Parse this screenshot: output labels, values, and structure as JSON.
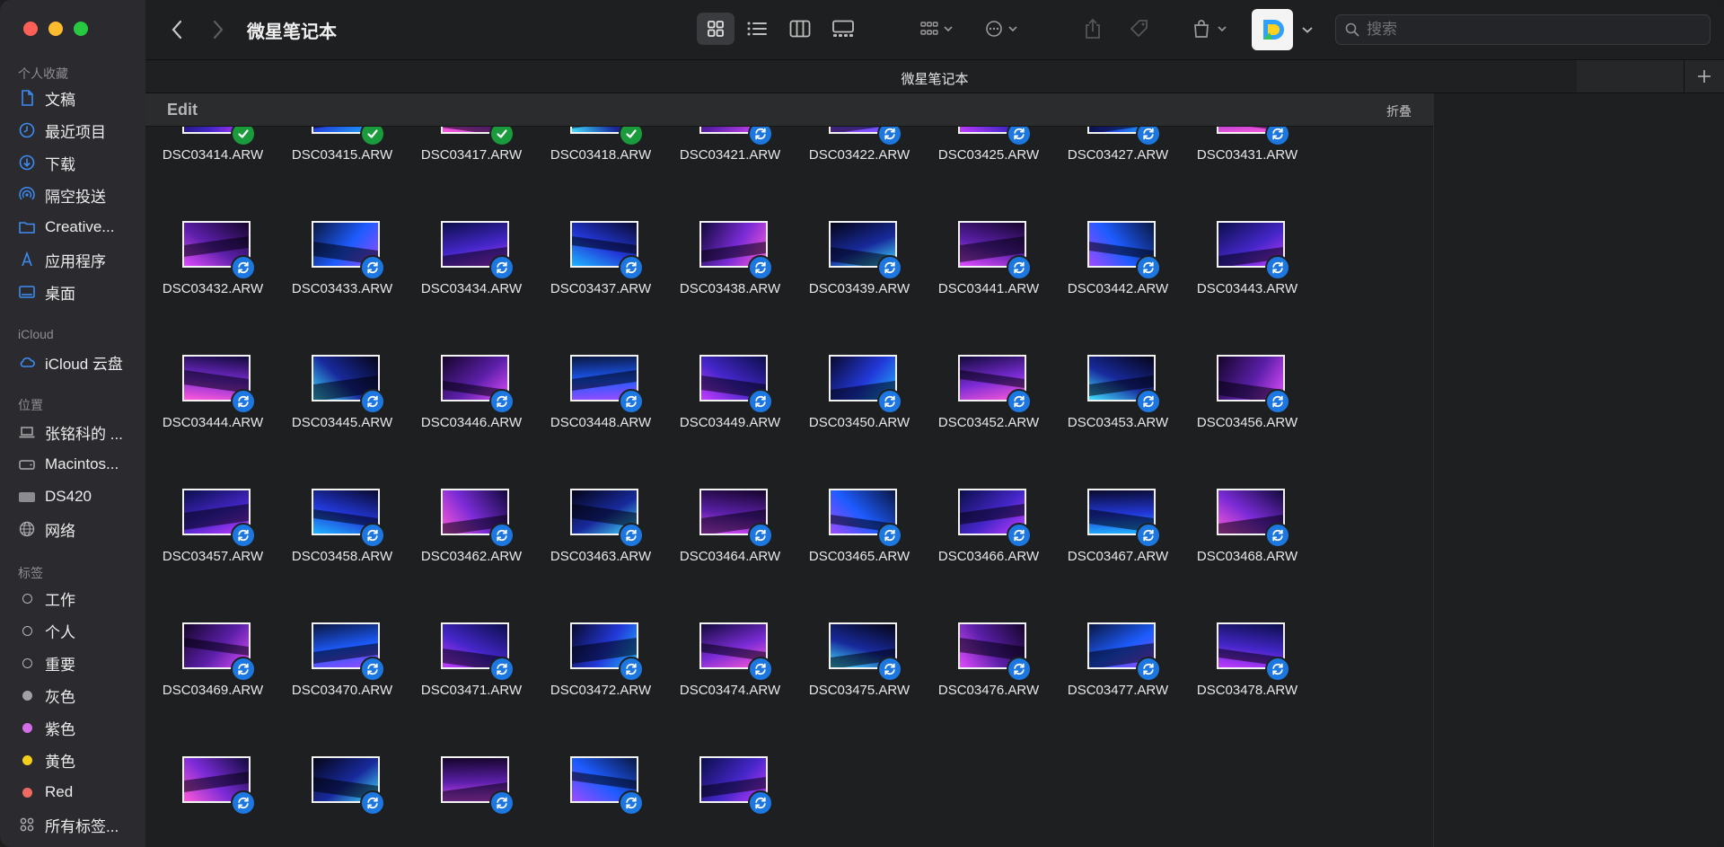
{
  "window": {
    "title": "微星笔记本",
    "tab_title": "微星笔记本",
    "traffic_colors": [
      "#fe5f57",
      "#febc2e",
      "#28c840"
    ]
  },
  "search": {
    "placeholder": "搜索",
    "value": ""
  },
  "sidebar": {
    "sections": [
      {
        "title": "个人收藏",
        "items": [
          {
            "label": "文稿",
            "icon": "document-icon"
          },
          {
            "label": "最近项目",
            "icon": "clock-icon"
          },
          {
            "label": "下载",
            "icon": "download-icon"
          },
          {
            "label": "隔空投送",
            "icon": "airdrop-icon"
          },
          {
            "label": "Creative...",
            "icon": "folder-icon"
          },
          {
            "label": "应用程序",
            "icon": "applications-icon"
          },
          {
            "label": "桌面",
            "icon": "desktop-icon"
          }
        ]
      },
      {
        "title": "iCloud",
        "items": [
          {
            "label": "iCloud 云盘",
            "icon": "cloud-icon"
          }
        ]
      },
      {
        "title": "位置",
        "items": [
          {
            "label": "张铭科的 ...",
            "icon": "laptop-icon"
          },
          {
            "label": "Macintos...",
            "icon": "disk-icon"
          },
          {
            "label": "DS420",
            "icon": "nas-icon"
          },
          {
            "label": "网络",
            "icon": "network-icon"
          }
        ]
      },
      {
        "title": "标签",
        "items": [
          {
            "label": "工作",
            "icon": "tag-empty-icon",
            "color": ""
          },
          {
            "label": "个人",
            "icon": "tag-empty-icon",
            "color": ""
          },
          {
            "label": "重要",
            "icon": "tag-empty-icon",
            "color": ""
          },
          {
            "label": "灰色",
            "icon": "tag-gray-icon",
            "color": "#a2a2a6"
          },
          {
            "label": "紫色",
            "icon": "tag-purple-icon",
            "color": "#d36ee8"
          },
          {
            "label": "黄色",
            "icon": "tag-yellow-icon",
            "color": "#f5d01b"
          },
          {
            "label": "Red",
            "icon": "tag-red-icon",
            "color": "#f06a62"
          },
          {
            "label": "所有标签...",
            "icon": "all-tags-icon",
            "color": ""
          }
        ]
      }
    ]
  },
  "group": {
    "title": "Edit",
    "collapse_label": "折叠"
  },
  "files": [
    {
      "name": "DSC03414.ARW",
      "status": "done"
    },
    {
      "name": "DSC03415.ARW",
      "status": "done"
    },
    {
      "name": "DSC03417.ARW",
      "status": "done"
    },
    {
      "name": "DSC03418.ARW",
      "status": "done"
    },
    {
      "name": "DSC03421.ARW",
      "status": "sync"
    },
    {
      "name": "DSC03422.ARW",
      "status": "sync"
    },
    {
      "name": "DSC03425.ARW",
      "status": "sync"
    },
    {
      "name": "DSC03427.ARW",
      "status": "sync"
    },
    {
      "name": "DSC03431.ARW",
      "status": "sync"
    },
    {
      "name": "DSC03432.ARW",
      "status": "sync"
    },
    {
      "name": "DSC03433.ARW",
      "status": "sync"
    },
    {
      "name": "DSC03434.ARW",
      "status": "sync"
    },
    {
      "name": "DSC03437.ARW",
      "status": "sync"
    },
    {
      "name": "DSC03438.ARW",
      "status": "sync"
    },
    {
      "name": "DSC03439.ARW",
      "status": "sync"
    },
    {
      "name": "DSC03441.ARW",
      "status": "sync"
    },
    {
      "name": "DSC03442.ARW",
      "status": "sync"
    },
    {
      "name": "DSC03443.ARW",
      "status": "sync"
    },
    {
      "name": "DSC03444.ARW",
      "status": "sync"
    },
    {
      "name": "DSC03445.ARW",
      "status": "sync"
    },
    {
      "name": "DSC03446.ARW",
      "status": "sync"
    },
    {
      "name": "DSC03448.ARW",
      "status": "sync"
    },
    {
      "name": "DSC03449.ARW",
      "status": "sync"
    },
    {
      "name": "DSC03450.ARW",
      "status": "sync"
    },
    {
      "name": "DSC03452.ARW",
      "status": "sync"
    },
    {
      "name": "DSC03453.ARW",
      "status": "sync"
    },
    {
      "name": "DSC03456.ARW",
      "status": "sync"
    },
    {
      "name": "DSC03457.ARW",
      "status": "sync"
    },
    {
      "name": "DSC03458.ARW",
      "status": "sync"
    },
    {
      "name": "DSC03462.ARW",
      "status": "sync"
    },
    {
      "name": "DSC03463.ARW",
      "status": "sync"
    },
    {
      "name": "DSC03464.ARW",
      "status": "sync"
    },
    {
      "name": "DSC03465.ARW",
      "status": "sync"
    },
    {
      "name": "DSC03466.ARW",
      "status": "sync"
    },
    {
      "name": "DSC03467.ARW",
      "status": "sync"
    },
    {
      "name": "DSC03468.ARW",
      "status": "sync"
    },
    {
      "name": "DSC03469.ARW",
      "status": "sync"
    },
    {
      "name": "DSC03470.ARW",
      "status": "sync"
    },
    {
      "name": "DSC03471.ARW",
      "status": "sync"
    },
    {
      "name": "DSC03472.ARW",
      "status": "sync"
    },
    {
      "name": "DSC03474.ARW",
      "status": "sync"
    },
    {
      "name": "DSC03475.ARW",
      "status": "sync"
    },
    {
      "name": "DSC03476.ARW",
      "status": "sync"
    },
    {
      "name": "DSC03477.ARW",
      "status": "sync"
    },
    {
      "name": "DSC03478.ARW",
      "status": "sync"
    },
    {
      "name": "",
      "status": "sync"
    },
    {
      "name": "",
      "status": "sync"
    },
    {
      "name": "",
      "status": "sync"
    },
    {
      "name": "",
      "status": "sync"
    },
    {
      "name": "",
      "status": "sync"
    }
  ],
  "colors": {
    "sync_badge": "#1c78e0",
    "done_badge": "#1a9b3c"
  }
}
